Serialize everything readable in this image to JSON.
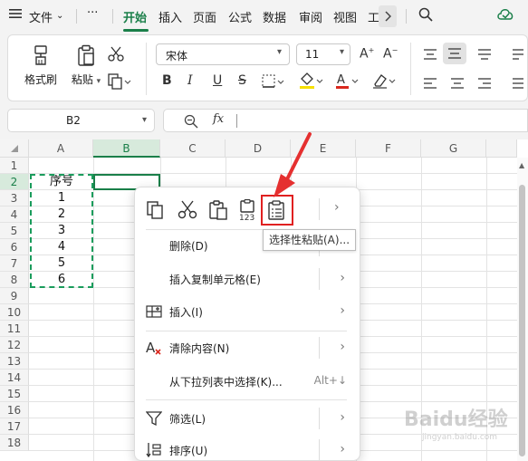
{
  "menubar": {
    "file_label": "文件",
    "more_label": "···",
    "tabs": [
      "开始",
      "插入",
      "页面",
      "公式",
      "数据",
      "审阅",
      "视图",
      "工"
    ],
    "active_tab": "开始"
  },
  "ribbon": {
    "format_painter": "格式刷",
    "paste": "粘贴",
    "font_name": "宋体",
    "font_size": "11",
    "bold": "B",
    "italic": "I",
    "underline": "U",
    "strike": "S",
    "font_color_letter": "A",
    "fill_color": "#f6e000",
    "font_color": "#d9281e"
  },
  "formula_bar": {
    "name_box": "B2",
    "fx_label": "fx",
    "value": ""
  },
  "grid": {
    "columns": [
      "A",
      "B",
      "C",
      "D",
      "E",
      "F",
      "G"
    ],
    "rows": [
      "1",
      "2",
      "3",
      "4",
      "5",
      "6",
      "7",
      "8",
      "9",
      "10",
      "11",
      "12",
      "13",
      "14",
      "15",
      "16",
      "17",
      "18"
    ],
    "cells": {
      "A2": "序号",
      "A3": "1",
      "A4": "2",
      "A5": "3",
      "A6": "4",
      "A7": "5",
      "A8": "6"
    },
    "selected_cell": "B2"
  },
  "context_menu": {
    "items": [
      {
        "label": "删除(D)",
        "shortcut": ""
      },
      {
        "label": "插入复制单元格(E)",
        "shortcut": ""
      },
      {
        "label": "插入(I)",
        "shortcut": ""
      },
      {
        "label": "清除内容(N)",
        "shortcut": ""
      },
      {
        "label": "从下拉列表中选择(K)...",
        "shortcut": "Alt+↓"
      },
      {
        "label": "筛选(L)",
        "shortcut": ""
      },
      {
        "label": "排序(U)",
        "shortcut": ""
      }
    ],
    "tooltip": "选择性粘贴(A)..."
  },
  "watermark": {
    "main": "Baidu经验",
    "sub": "jingyan.baidu.com"
  },
  "colors": {
    "accent": "#1a7f49",
    "highlight": "#e02020",
    "copy_border": "#1a9c5c"
  }
}
